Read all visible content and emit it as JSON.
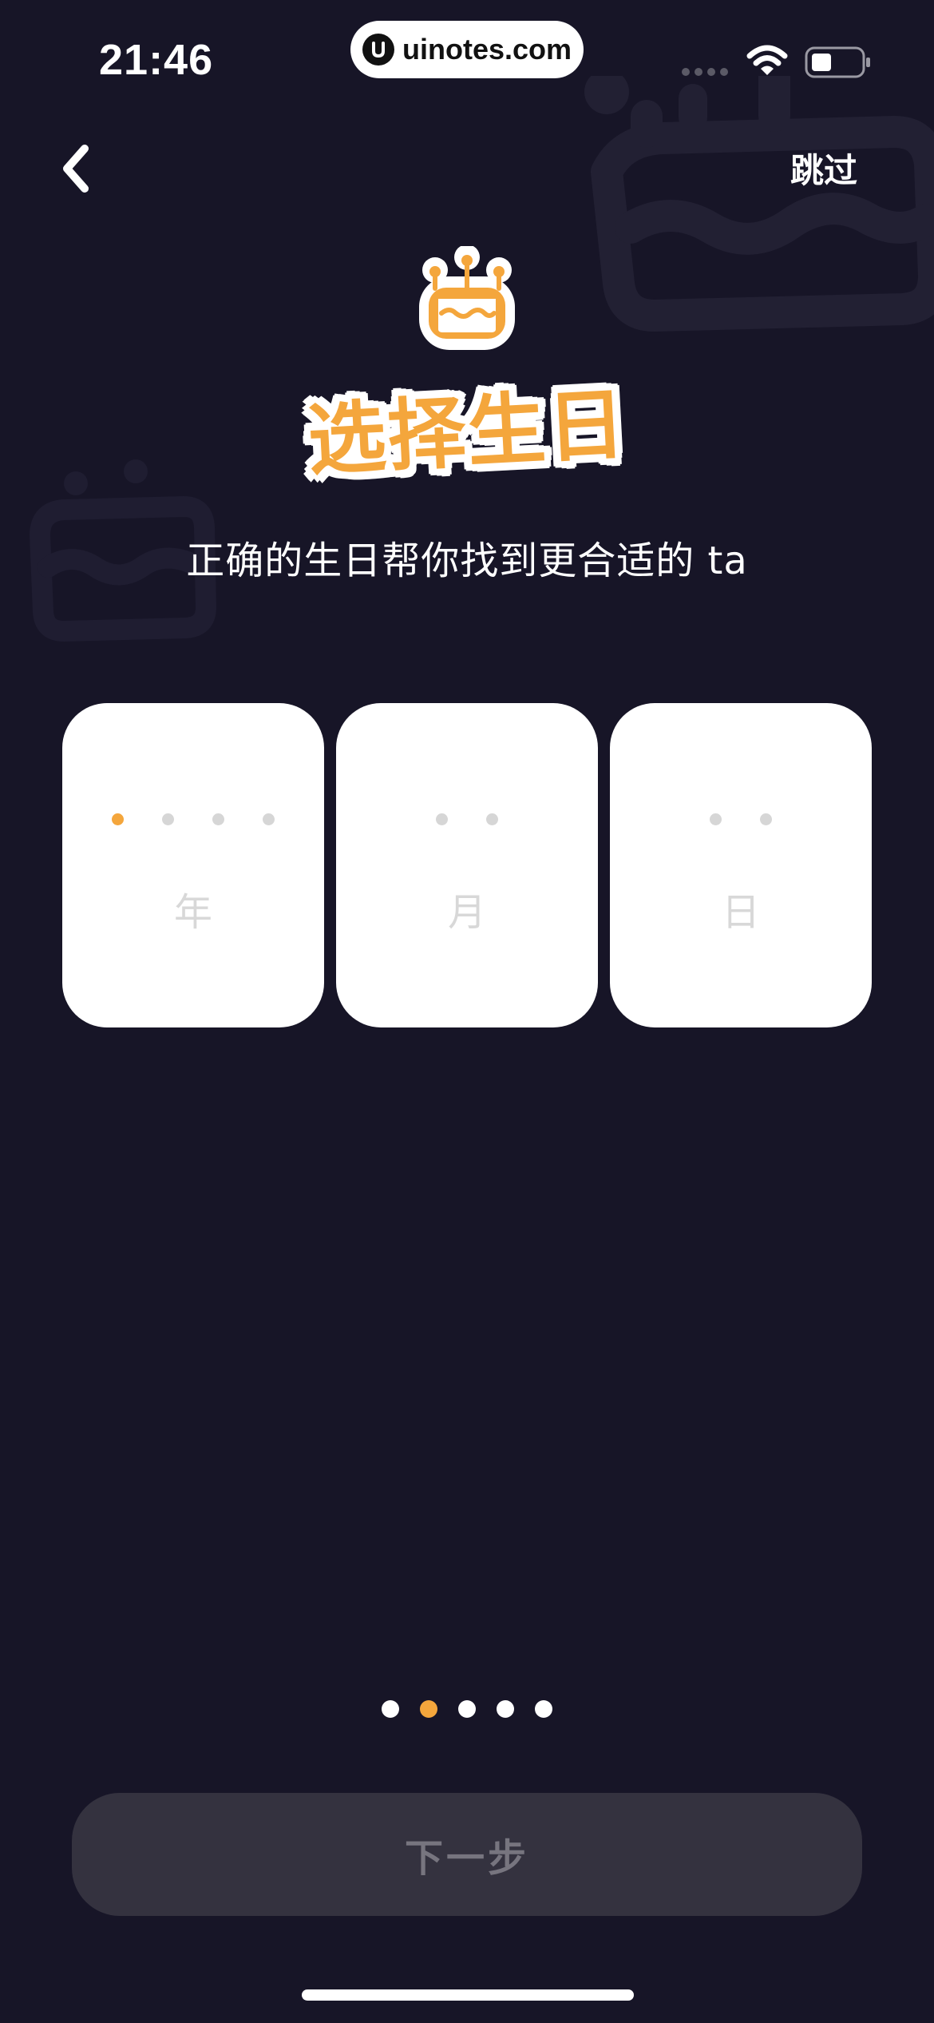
{
  "status_bar": {
    "time": "21:46",
    "url": "uinotes.com"
  },
  "nav": {
    "back_icon": "chevron-left-icon",
    "skip_label": "跳过"
  },
  "header": {
    "icon": "birthday-cake-icon",
    "title": "选择生日",
    "subtitle": "正确的生日帮你找到更合适的 ta"
  },
  "date_picker": {
    "fields": [
      {
        "label": "年",
        "digits": 4,
        "active_digit": 1
      },
      {
        "label": "月",
        "digits": 2,
        "active_digit": 0
      },
      {
        "label": "日",
        "digits": 2,
        "active_digit": 0
      }
    ]
  },
  "pager": {
    "total": 5,
    "current": 2
  },
  "footer": {
    "next_label": "下一步"
  },
  "colors": {
    "background": "#171527",
    "accent": "#f4a63c",
    "button_disabled_bg": "#34323f",
    "button_disabled_text": "#77757f"
  }
}
